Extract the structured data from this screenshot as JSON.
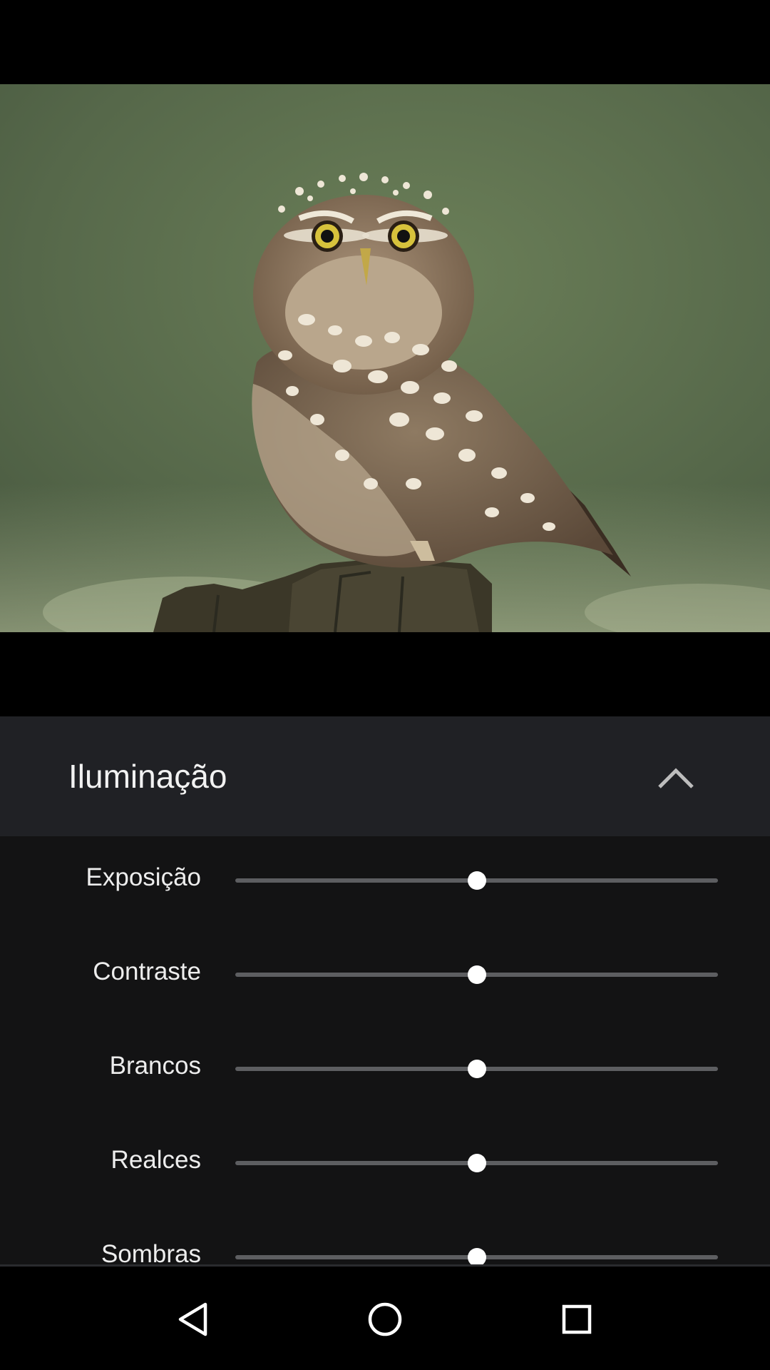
{
  "panel": {
    "title": "Iluminação",
    "collapse_icon": "chevron-up-icon"
  },
  "adjustments": [
    {
      "label": "Exposição",
      "value": 0.5
    },
    {
      "label": "Contraste",
      "value": 0.5
    },
    {
      "label": "Brancos",
      "value": 0.5
    },
    {
      "label": "Realces",
      "value": 0.5
    },
    {
      "label": "Sombras",
      "value": 0.5
    }
  ],
  "nav": {
    "back_icon": "back-triangle-icon",
    "home_icon": "home-circle-icon",
    "recents_icon": "recents-square-icon"
  },
  "colors": {
    "panel_header": "#202125",
    "panel_body": "#131314",
    "slider_track": "#5d5e61",
    "slider_thumb": "#ffffff"
  }
}
